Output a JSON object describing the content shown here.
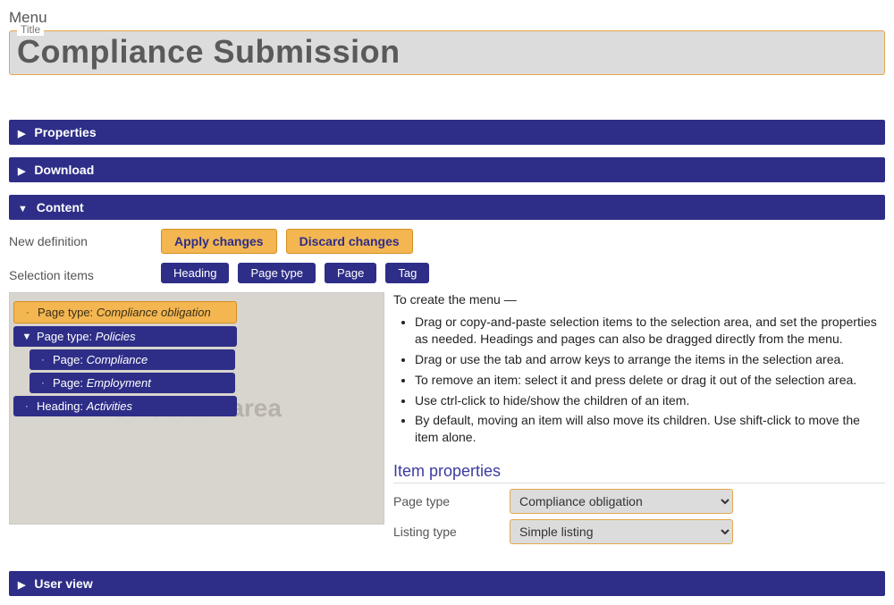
{
  "breadcrumb": "Menu",
  "title_label": "Title",
  "title_value": "Compliance Submission",
  "accordions": {
    "properties": "Properties",
    "download": "Download",
    "content": "Content",
    "user_view": "User view"
  },
  "content": {
    "new_definition_label": "New definition",
    "apply_label": "Apply changes",
    "discard_label": "Discard changes",
    "selection_items_label": "Selection items",
    "pills": {
      "heading": "Heading",
      "page_type": "Page type",
      "page": "Page",
      "tag": "Tag"
    },
    "selection_area": {
      "watermark": "Selection area",
      "items": [
        {
          "indent": 0,
          "toggle": "·",
          "type": "Page type:",
          "value": "Compliance obligation",
          "selected": true
        },
        {
          "indent": 0,
          "toggle": "▼",
          "type": "Page type:",
          "value": "Policies",
          "selected": false
        },
        {
          "indent": 1,
          "toggle": "·",
          "type": "Page:",
          "value": "Compliance",
          "selected": false
        },
        {
          "indent": 1,
          "toggle": "·",
          "type": "Page:",
          "value": "Employment",
          "selected": false
        },
        {
          "indent": 0,
          "toggle": "·",
          "type": "Heading:",
          "value": "Activities",
          "selected": false
        }
      ]
    },
    "instructions": {
      "intro": "To create the menu —",
      "bullets": [
        "Drag or copy-and-paste selection items to the selection area, and set the properties as needed. Headings and pages can also be dragged directly from the menu.",
        "Drag or use the tab and arrow keys to arrange the items in the selection area.",
        "To remove an item: select it and press delete or drag it out of the selection area.",
        "Use ctrl-click to hide/show the children of an item.",
        "By default, moving an item will also move its children. Use shift-click to move the item alone."
      ]
    },
    "item_properties_heading": "Item properties",
    "item_props": {
      "page_type_label": "Page type",
      "page_type_value": "Compliance obligation",
      "listing_type_label": "Listing type",
      "listing_type_value": "Simple listing"
    }
  }
}
